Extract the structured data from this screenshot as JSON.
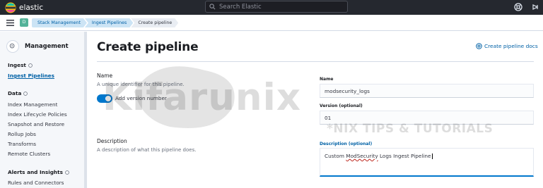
{
  "topbar": {
    "brand": "elastic",
    "search_placeholder": "Search Elastic"
  },
  "breadcrumbs": [
    "Stack Management",
    "Ingest Pipelines",
    "Create pipeline"
  ],
  "space_avatar": "D",
  "sidebar": {
    "title": "Management",
    "groups": [
      {
        "label": "Ingest",
        "items": [
          "Ingest Pipelines"
        ],
        "active": "Ingest Pipelines"
      },
      {
        "label": "Data",
        "items": [
          "Index Management",
          "Index Lifecycle Policies",
          "Snapshot and Restore",
          "Rollup Jobs",
          "Transforms",
          "Remote Clusters"
        ]
      },
      {
        "label": "Alerts and Insights",
        "items": [
          "Rules and Connectors"
        ]
      }
    ]
  },
  "main": {
    "title": "Create pipeline",
    "docs_link": "Create pipeline docs",
    "name_section": {
      "title": "Name",
      "description": "A unique identifier for this pipeline.",
      "toggle_label": "Add version number",
      "toggle_on": true
    },
    "description_section": {
      "title": "Description",
      "description": "A description of what this pipeline does."
    },
    "fields": {
      "name_label": "Name",
      "name_value": "modsecurity_logs",
      "version_label": "Version (optional)",
      "version_value": "01",
      "description_label": "Description (optional)",
      "description_value_prefix": "Custom ",
      "description_value_misspelled": "ModSecurity",
      "description_value_suffix": " Logs Ingest Pipeline"
    }
  },
  "watermark": {
    "main": "Kifarunix",
    "sub": "*NIX TIPS & TUTORIALS"
  },
  "colors": {
    "topbar": "#25282f",
    "link": "#0061a6",
    "accent": "#0077cc",
    "sidebar_bg": "#f5f7fa",
    "avatar": "#54b399"
  }
}
